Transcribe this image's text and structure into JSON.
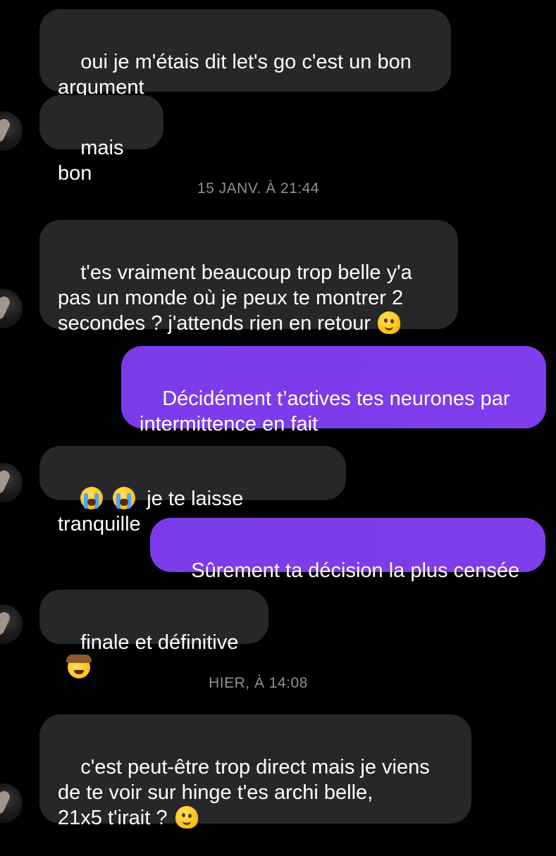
{
  "messages": [
    {
      "direction": "incoming",
      "text": "oui je m'étais dit let's go c'est un bon\nargument"
    },
    {
      "direction": "incoming",
      "text": "mais bon"
    },
    {
      "type": "timestamp",
      "text": "15 JANV. À 21:44"
    },
    {
      "direction": "incoming",
      "text": "t'es vraiment beaucoup trop belle y'a\npas un monde où je peux te montrer 2\nsecondes ? j'attends rien en retour",
      "emoji": "melting-face-emoji"
    },
    {
      "direction": "outgoing",
      "text": "Décidément t’actives tes neurones par\nintermittence en fait"
    },
    {
      "direction": "incoming",
      "text": "je te laisse tranquille",
      "emoji_prefix": [
        "loudly-crying-face-emoji",
        "loudly-crying-face-emoji"
      ]
    },
    {
      "direction": "outgoing",
      "text": "Sûrement ta décision la plus censée"
    },
    {
      "direction": "incoming",
      "text": "finale et définitive",
      "emoji": "cowboy-hat-face-emoji"
    },
    {
      "type": "timestamp",
      "text": "HIER, À 14:08"
    },
    {
      "direction": "incoming",
      "text": "c'est peut-être trop direct mais je viens\nde te voir sur hinge t'es archi belle,\n21x5 t'irait ?",
      "emoji": "melting-face-emoji"
    }
  ],
  "colors": {
    "background": "#000000",
    "incoming_bubble": "#262729",
    "outgoing_bubble": "#7a3ceb",
    "timestamp_text": "#8f9094",
    "text": "#ffffff"
  },
  "icons": {
    "avatar": "contact-avatar"
  }
}
